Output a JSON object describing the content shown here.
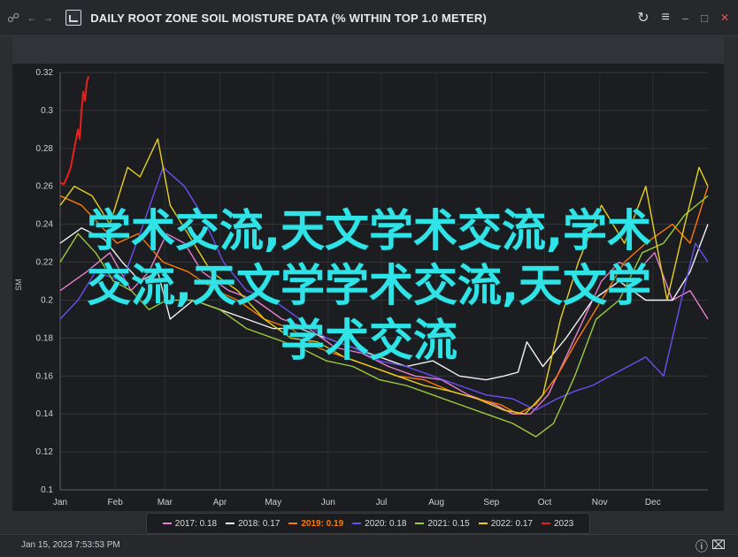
{
  "window": {
    "title": "DAILY ROOT ZONE SOIL MOISTURE DATA (% WITHIN TOP 1.0 METER)",
    "icons": [
      "link-icon",
      "back-arrow-icon",
      "forward-arrow-icon",
      "chart-app-icon",
      "refresh-icon",
      "menu-icon",
      "minimize-icon",
      "maximize-icon",
      "close-icon"
    ]
  },
  "status": {
    "date": "Jan 15, 2023 7:53:53 PM",
    "icons": [
      "info-icon",
      "export-icon"
    ]
  },
  "overlay": {
    "lines": [
      "学术交流,天文学术交流,学术",
      "交流,天文学学术交流,天文学",
      "学术交流"
    ],
    "color": "#2fe3e7"
  },
  "chart_data": {
    "type": "line",
    "title": "DAILY ROOT ZONE SOIL MOISTURE DATA (% WITHIN TOP 1.0 METER)",
    "ylabel": "SM",
    "xlabel": "",
    "ylim": [
      0.1,
      0.32
    ],
    "yticks": [
      0.1,
      0.12,
      0.14,
      0.16,
      0.18,
      0.2,
      0.22,
      0.24,
      0.26,
      0.28,
      0.3,
      0.32
    ],
    "xlim": [
      0,
      365
    ],
    "xticks": [
      {
        "label": "Jan",
        "day": 0
      },
      {
        "label": "Feb",
        "day": 31
      },
      {
        "label": "Mar",
        "day": 59
      },
      {
        "label": "Apr",
        "day": 90
      },
      {
        "label": "May",
        "day": 120
      },
      {
        "label": "Jun",
        "day": 151
      },
      {
        "label": "Jul",
        "day": 181
      },
      {
        "label": "Aug",
        "day": 212
      },
      {
        "label": "Sep",
        "day": 243
      },
      {
        "label": "Oct",
        "day": 273
      },
      {
        "label": "Nov",
        "day": 304
      },
      {
        "label": "Dec",
        "day": 334
      }
    ],
    "grid": true,
    "legend_position": "bottom",
    "series": [
      {
        "name": "2017",
        "legend": "2017: 0.18",
        "color": "#e87fd0",
        "points": [
          [
            0,
            0.205
          ],
          [
            15,
            0.215
          ],
          [
            28,
            0.225
          ],
          [
            40,
            0.205
          ],
          [
            50,
            0.215
          ],
          [
            60,
            0.235
          ],
          [
            70,
            0.23
          ],
          [
            80,
            0.215
          ],
          [
            95,
            0.205
          ],
          [
            110,
            0.2
          ],
          [
            125,
            0.19
          ],
          [
            140,
            0.185
          ],
          [
            155,
            0.175
          ],
          [
            170,
            0.172
          ],
          [
            185,
            0.165
          ],
          [
            200,
            0.16
          ],
          [
            215,
            0.158
          ],
          [
            230,
            0.15
          ],
          [
            245,
            0.145
          ],
          [
            255,
            0.14
          ],
          [
            265,
            0.14
          ],
          [
            275,
            0.15
          ],
          [
            285,
            0.17
          ],
          [
            295,
            0.19
          ],
          [
            305,
            0.21
          ],
          [
            315,
            0.22
          ],
          [
            325,
            0.215
          ],
          [
            335,
            0.225
          ],
          [
            345,
            0.2
          ],
          [
            355,
            0.205
          ],
          [
            365,
            0.19
          ]
        ]
      },
      {
        "name": "2018",
        "legend": "2018: 0.17",
        "color": "#f2f2f2",
        "points": [
          [
            0,
            0.23
          ],
          [
            12,
            0.238
          ],
          [
            25,
            0.232
          ],
          [
            35,
            0.22
          ],
          [
            45,
            0.21
          ],
          [
            55,
            0.215
          ],
          [
            62,
            0.19
          ],
          [
            75,
            0.2
          ],
          [
            90,
            0.195
          ],
          [
            105,
            0.19
          ],
          [
            120,
            0.185
          ],
          [
            135,
            0.185
          ],
          [
            150,
            0.18
          ],
          [
            165,
            0.175
          ],
          [
            180,
            0.17
          ],
          [
            195,
            0.165
          ],
          [
            210,
            0.168
          ],
          [
            225,
            0.16
          ],
          [
            240,
            0.158
          ],
          [
            250,
            0.16
          ],
          [
            258,
            0.162
          ],
          [
            263,
            0.178
          ],
          [
            272,
            0.165
          ],
          [
            285,
            0.18
          ],
          [
            300,
            0.2
          ],
          [
            315,
            0.21
          ],
          [
            330,
            0.2
          ],
          [
            345,
            0.2
          ],
          [
            355,
            0.215
          ],
          [
            365,
            0.24
          ]
        ]
      },
      {
        "name": "2019",
        "legend": "2019: 0.19",
        "color": "#ff7a00",
        "points": [
          [
            0,
            0.255
          ],
          [
            12,
            0.25
          ],
          [
            22,
            0.24
          ],
          [
            32,
            0.23
          ],
          [
            44,
            0.235
          ],
          [
            58,
            0.22
          ],
          [
            72,
            0.215
          ],
          [
            88,
            0.205
          ],
          [
            100,
            0.2
          ],
          [
            115,
            0.19
          ],
          [
            130,
            0.185
          ],
          [
            145,
            0.175
          ],
          [
            160,
            0.17
          ],
          [
            175,
            0.165
          ],
          [
            190,
            0.16
          ],
          [
            205,
            0.158
          ],
          [
            220,
            0.152
          ],
          [
            235,
            0.148
          ],
          [
            248,
            0.145
          ],
          [
            258,
            0.14
          ],
          [
            268,
            0.145
          ],
          [
            280,
            0.16
          ],
          [
            292,
            0.18
          ],
          [
            305,
            0.2
          ],
          [
            318,
            0.22
          ],
          [
            330,
            0.23
          ],
          [
            345,
            0.24
          ],
          [
            355,
            0.23
          ],
          [
            365,
            0.26
          ]
        ]
      },
      {
        "name": "2020",
        "legend": "2020: 0.18",
        "color": "#6a4ff0",
        "points": [
          [
            0,
            0.19
          ],
          [
            10,
            0.2
          ],
          [
            20,
            0.215
          ],
          [
            35,
            0.21
          ],
          [
            45,
            0.235
          ],
          [
            58,
            0.27
          ],
          [
            70,
            0.26
          ],
          [
            80,
            0.245
          ],
          [
            92,
            0.22
          ],
          [
            105,
            0.205
          ],
          [
            120,
            0.2
          ],
          [
            135,
            0.19
          ],
          [
            150,
            0.18
          ],
          [
            165,
            0.175
          ],
          [
            180,
            0.168
          ],
          [
            195,
            0.165
          ],
          [
            210,
            0.16
          ],
          [
            225,
            0.155
          ],
          [
            240,
            0.15
          ],
          [
            255,
            0.148
          ],
          [
            268,
            0.142
          ],
          [
            280,
            0.148
          ],
          [
            290,
            0.152
          ],
          [
            300,
            0.155
          ],
          [
            310,
            0.16
          ],
          [
            320,
            0.165
          ],
          [
            330,
            0.17
          ],
          [
            340,
            0.16
          ],
          [
            350,
            0.2
          ],
          [
            358,
            0.23
          ],
          [
            365,
            0.22
          ]
        ]
      },
      {
        "name": "2021",
        "legend": "2021: 0.15",
        "color": "#9ccc3c",
        "points": [
          [
            0,
            0.22
          ],
          [
            10,
            0.235
          ],
          [
            20,
            0.225
          ],
          [
            30,
            0.21
          ],
          [
            40,
            0.205
          ],
          [
            50,
            0.195
          ],
          [
            60,
            0.2
          ],
          [
            75,
            0.2
          ],
          [
            90,
            0.195
          ],
          [
            105,
            0.185
          ],
          [
            120,
            0.18
          ],
          [
            135,
            0.175
          ],
          [
            150,
            0.168
          ],
          [
            165,
            0.165
          ],
          [
            180,
            0.158
          ],
          [
            195,
            0.155
          ],
          [
            210,
            0.15
          ],
          [
            225,
            0.145
          ],
          [
            240,
            0.14
          ],
          [
            255,
            0.135
          ],
          [
            268,
            0.128
          ],
          [
            278,
            0.135
          ],
          [
            290,
            0.16
          ],
          [
            302,
            0.19
          ],
          [
            315,
            0.2
          ],
          [
            328,
            0.225
          ],
          [
            340,
            0.23
          ],
          [
            352,
            0.245
          ],
          [
            365,
            0.255
          ]
        ]
      },
      {
        "name": "2022",
        "legend": "2022: 0.17",
        "color": "#e6d21e",
        "points": [
          [
            0,
            0.25
          ],
          [
            8,
            0.26
          ],
          [
            18,
            0.255
          ],
          [
            28,
            0.24
          ],
          [
            38,
            0.27
          ],
          [
            45,
            0.265
          ],
          [
            55,
            0.285
          ],
          [
            62,
            0.25
          ],
          [
            72,
            0.235
          ],
          [
            85,
            0.215
          ],
          [
            100,
            0.205
          ],
          [
            115,
            0.19
          ],
          [
            130,
            0.18
          ],
          [
            145,
            0.178
          ],
          [
            160,
            0.17
          ],
          [
            175,
            0.165
          ],
          [
            190,
            0.16
          ],
          [
            205,
            0.155
          ],
          [
            220,
            0.152
          ],
          [
            235,
            0.148
          ],
          [
            250,
            0.142
          ],
          [
            262,
            0.14
          ],
          [
            272,
            0.15
          ],
          [
            282,
            0.19
          ],
          [
            292,
            0.22
          ],
          [
            305,
            0.25
          ],
          [
            318,
            0.23
          ],
          [
            330,
            0.26
          ],
          [
            342,
            0.2
          ],
          [
            352,
            0.24
          ],
          [
            360,
            0.27
          ],
          [
            365,
            0.26
          ]
        ]
      },
      {
        "name": "2023",
        "legend": "2023",
        "color": "#e8201e",
        "points": [
          [
            0,
            0.262
          ],
          [
            2,
            0.261
          ],
          [
            4,
            0.265
          ],
          [
            6,
            0.27
          ],
          [
            8,
            0.28
          ],
          [
            10,
            0.29
          ],
          [
            11,
            0.285
          ],
          [
            12,
            0.3
          ],
          [
            13,
            0.31
          ],
          [
            14,
            0.305
          ],
          [
            15,
            0.315
          ],
          [
            16,
            0.318
          ]
        ]
      }
    ]
  }
}
